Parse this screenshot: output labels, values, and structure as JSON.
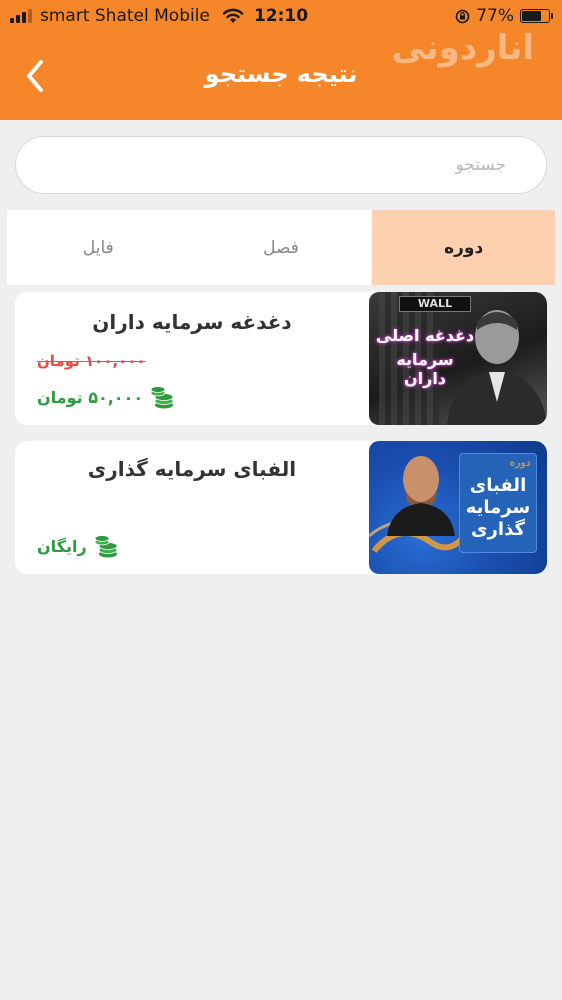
{
  "status_bar": {
    "carrier": "smart Shatel Mobile",
    "time": "12:10",
    "battery_text": "77%",
    "battery_level": 0.77
  },
  "header": {
    "title": "نتیجه جستجو",
    "watermark": "اناردونی",
    "bg_color": "#f5862a"
  },
  "search": {
    "placeholder": "جستجو",
    "value": ""
  },
  "tabs": [
    {
      "label": "دوره",
      "active": true
    },
    {
      "label": "فصل",
      "active": false
    },
    {
      "label": "فایل",
      "active": false
    }
  ],
  "results": [
    {
      "title": "دغدغه سرمایه داران",
      "old_price": "۱۰۰,۰۰۰ تومان",
      "price": "۵۰,۰۰۰ تومان",
      "thumb": {
        "sign_text": "WALL",
        "line1": "دغدغه اصلی",
        "line2": "سرمایه داران"
      }
    },
    {
      "title": "الفبای سرمایه گذاری",
      "old_price": "",
      "price": "رایگان",
      "thumb": {
        "badge": "دوره",
        "line1": "الفبای",
        "line2": "سرمایه",
        "line3": "گذاری"
      }
    }
  ],
  "colors": {
    "accent": "#f5862a",
    "active_tab": "#fdd1b0",
    "price_green": "#2f9a3e",
    "old_price_red": "#e94a4a"
  }
}
